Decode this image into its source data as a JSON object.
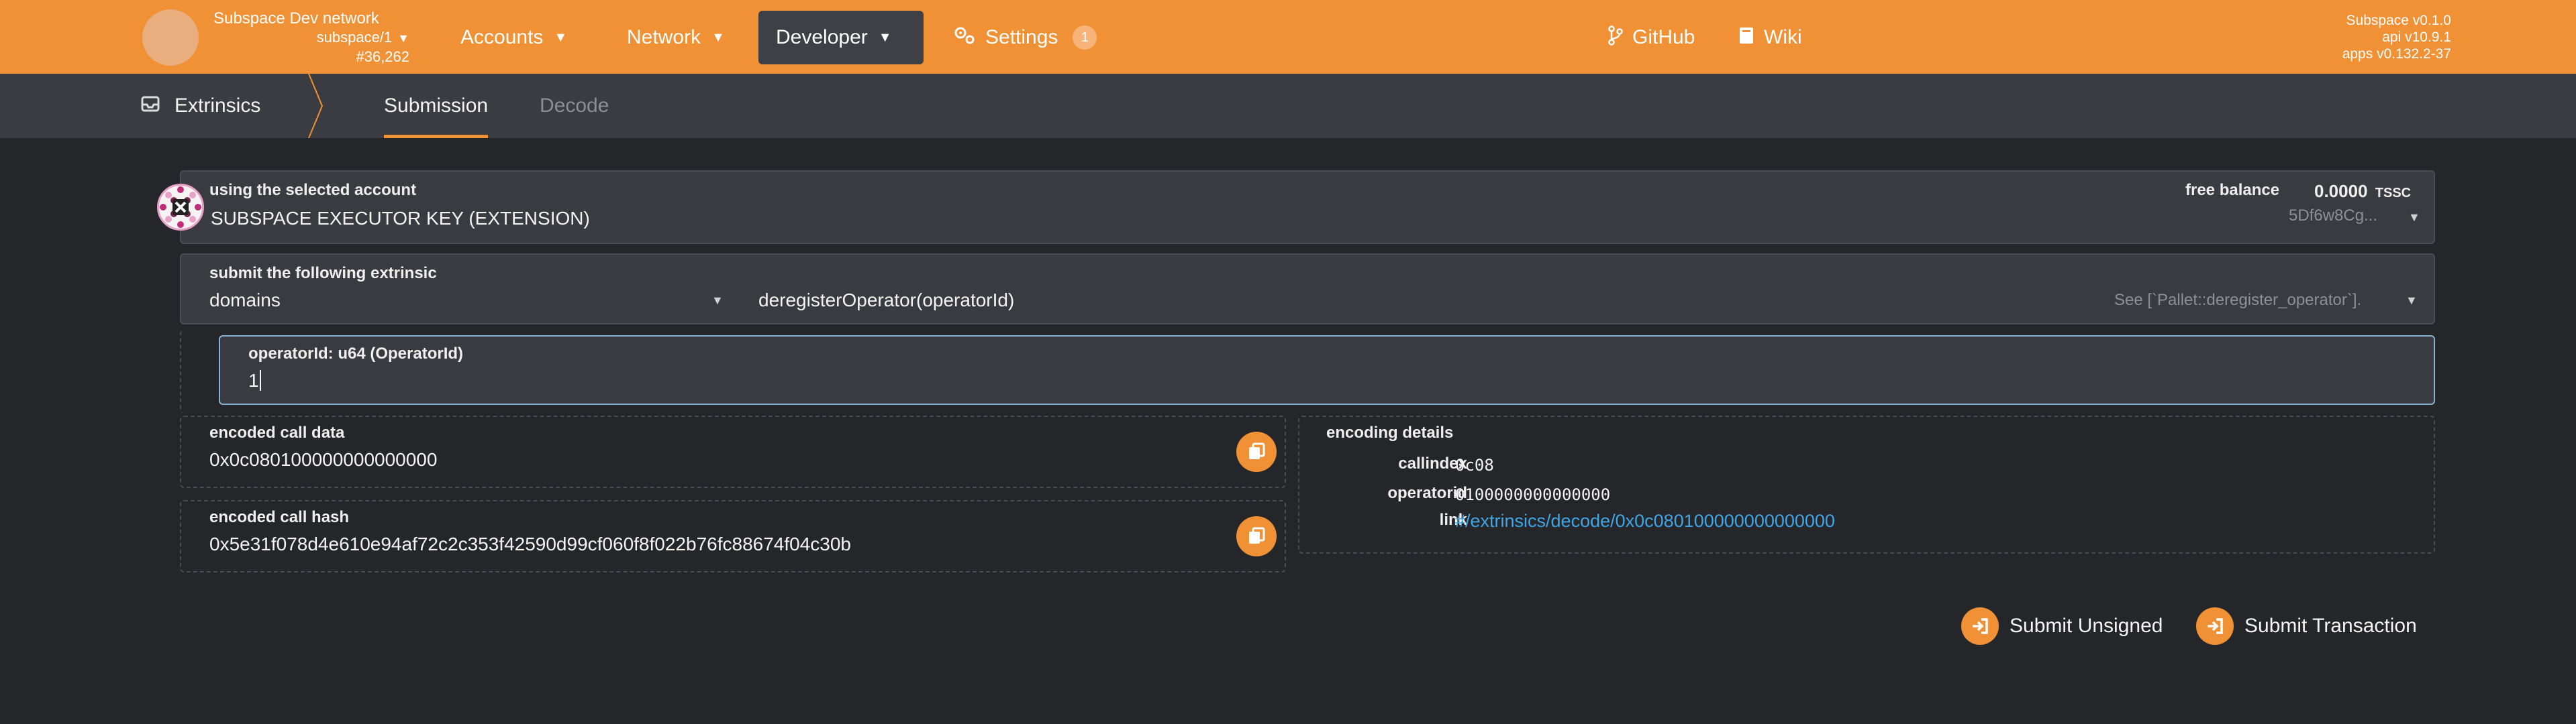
{
  "header": {
    "chain_name": "Subspace Dev network",
    "chain_spec": "subspace/1",
    "block": "#36,262",
    "menu": {
      "accounts": "Accounts",
      "network": "Network",
      "developer": "Developer",
      "settings": "Settings",
      "settings_badge": "1",
      "github": "GitHub",
      "wiki": "Wiki"
    },
    "versions": {
      "node": "Subspace v0.1.0",
      "api": "api v10.9.1",
      "apps": "apps v0.132.2-37"
    },
    "accent_color": "#f19135"
  },
  "subnav": {
    "section": "Extrinsics",
    "tabs": [
      "Submission",
      "Decode"
    ]
  },
  "account": {
    "label": "using the selected account",
    "name": "SUBSPACE EXECUTOR KEY (EXTENSION)",
    "balance_label": "free balance",
    "balance_value": "0.0000",
    "balance_unit": "TSSC",
    "address": "5Df6w8Cg..."
  },
  "extrinsic": {
    "label": "submit the following extrinsic",
    "pallet": "domains",
    "method": "deregisterOperator(operatorId)",
    "doc": "See [`Pallet::deregister_operator`]."
  },
  "param": {
    "label": "operatorId: u64 (OperatorId)",
    "value": "1"
  },
  "call_data": {
    "label": "encoded call data",
    "value": "0x0c080100000000000000"
  },
  "call_hash": {
    "label": "encoded call hash",
    "value": "0x5e31f078d4e610e94af72c2c353f42590d99cf060f8f022b76fc88674f04c30b"
  },
  "encoding": {
    "label": "encoding details",
    "callindex_label": "callindex",
    "callindex_value": "0c08",
    "operatorid_label": "operatorid",
    "operatorid_value": "0100000000000000",
    "link_label": "link",
    "link_value": "#/extrinsics/decode/0x0c080100000000000000"
  },
  "actions": {
    "submit_unsigned": "Submit Unsigned",
    "submit_transaction": "Submit Transaction"
  }
}
